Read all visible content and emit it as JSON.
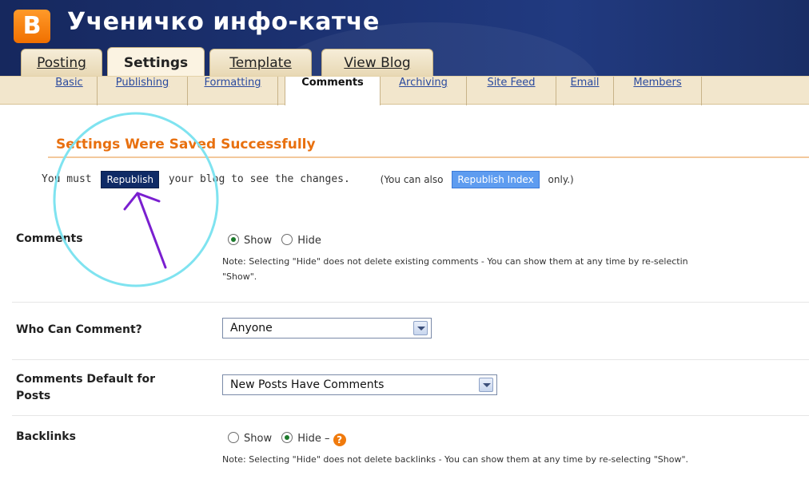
{
  "header": {
    "blog_title": "Ученичко инфо-катче",
    "logo_letter": "B"
  },
  "main_tabs": [
    {
      "label": "Posting",
      "active": false
    },
    {
      "label": "Settings",
      "active": true
    },
    {
      "label": "Template",
      "active": false
    },
    {
      "label": "View Blog",
      "active": false
    }
  ],
  "sub_tabs": [
    {
      "label": "Basic",
      "active": false
    },
    {
      "label": "Publishing",
      "active": false
    },
    {
      "label": "Formatting",
      "active": false
    },
    {
      "label": "Comments",
      "active": true
    },
    {
      "label": "Archiving",
      "active": false
    },
    {
      "label": "Site Feed",
      "active": false
    },
    {
      "label": "Email",
      "active": false
    },
    {
      "label": "Members",
      "active": false
    }
  ],
  "success": {
    "title": "Settings Were Saved Successfully",
    "you_must": "You must",
    "republish_button": "Republish",
    "your_blog": "your blog to see the changes.",
    "also_prefix": "(You can also",
    "republish_index_button": "Republish Index",
    "also_suffix": "only.)"
  },
  "settings": {
    "comments": {
      "label": "Comments",
      "option_show": "Show",
      "option_hide": "Hide",
      "selected": "Show",
      "note_line1": "Note: Selecting \"Hide\" does not delete existing comments - You can show them at any time by re-selectin",
      "note_line2": "\"Show\"."
    },
    "who_can_comment": {
      "label": "Who Can Comment?",
      "value": "Anyone"
    },
    "comments_default": {
      "label_line1": "Comments Default for",
      "label_line2": "Posts",
      "value": "New Posts Have Comments"
    },
    "backlinks": {
      "label": "Backlinks",
      "option_show": "Show",
      "option_hide": "Hide",
      "selected": "Hide",
      "dash": "–",
      "help_glyph": "?",
      "note": "Note: Selecting \"Hide\" does not delete backlinks - You can show them at any time by re-selecting \"Show\"."
    }
  },
  "colors": {
    "header_bg": "#1a2e66",
    "accent_orange": "#e8700f",
    "annotation_circle": "#7fe3f0",
    "annotation_arrow": "#7a1fd0"
  },
  "icons": {
    "logo": "blogger-logo-icon",
    "help": "help-icon",
    "dropdown": "chevron-down-icon"
  }
}
